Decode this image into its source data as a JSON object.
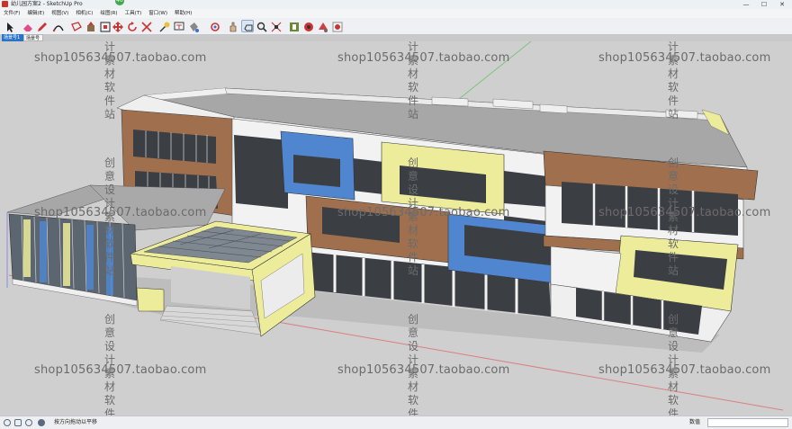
{
  "window": {
    "title": "幼儿园方案2 - SketchUp Pro",
    "notification_badge": "40",
    "minimize": "—",
    "maximize": "☐",
    "close": "✕"
  },
  "menu": [
    "文件(F)",
    "编辑(E)",
    "视图(V)",
    "相机(C)",
    "绘图(R)",
    "工具(T)",
    "窗口(W)",
    "帮助(H)"
  ],
  "toolbar": {
    "tools": [
      "select-icon",
      "eraser-icon",
      "pencil-icon",
      "arc-icon",
      "rectangle-icon",
      "push-pull-icon",
      "offset-icon",
      "move-icon",
      "rotate-icon",
      "scale-icon",
      "tape-measure-icon",
      "text-icon",
      "paint-bucket-icon",
      "orbit-icon",
      "pan-icon",
      "zoom-icon",
      "zoom-extents-icon",
      "previous-view-icon",
      "components-icon",
      "materials-icon",
      "styles-icon"
    ]
  },
  "scene_tabs": [
    "场景号1",
    "场景号3"
  ],
  "watermark": {
    "shop": "shop105634507.taobao.com",
    "vertical": "创意设计素材软件站"
  },
  "status": {
    "hint": "按方向拖动以平移",
    "value_label": "数值",
    "value": ""
  },
  "colors": {
    "brown": "#a0704e",
    "blue": "#4f86cf",
    "yellow": "#ecec9a",
    "white": "#f2f2f2",
    "roof": "#a9a9a9",
    "glass": "#3b3f44"
  }
}
